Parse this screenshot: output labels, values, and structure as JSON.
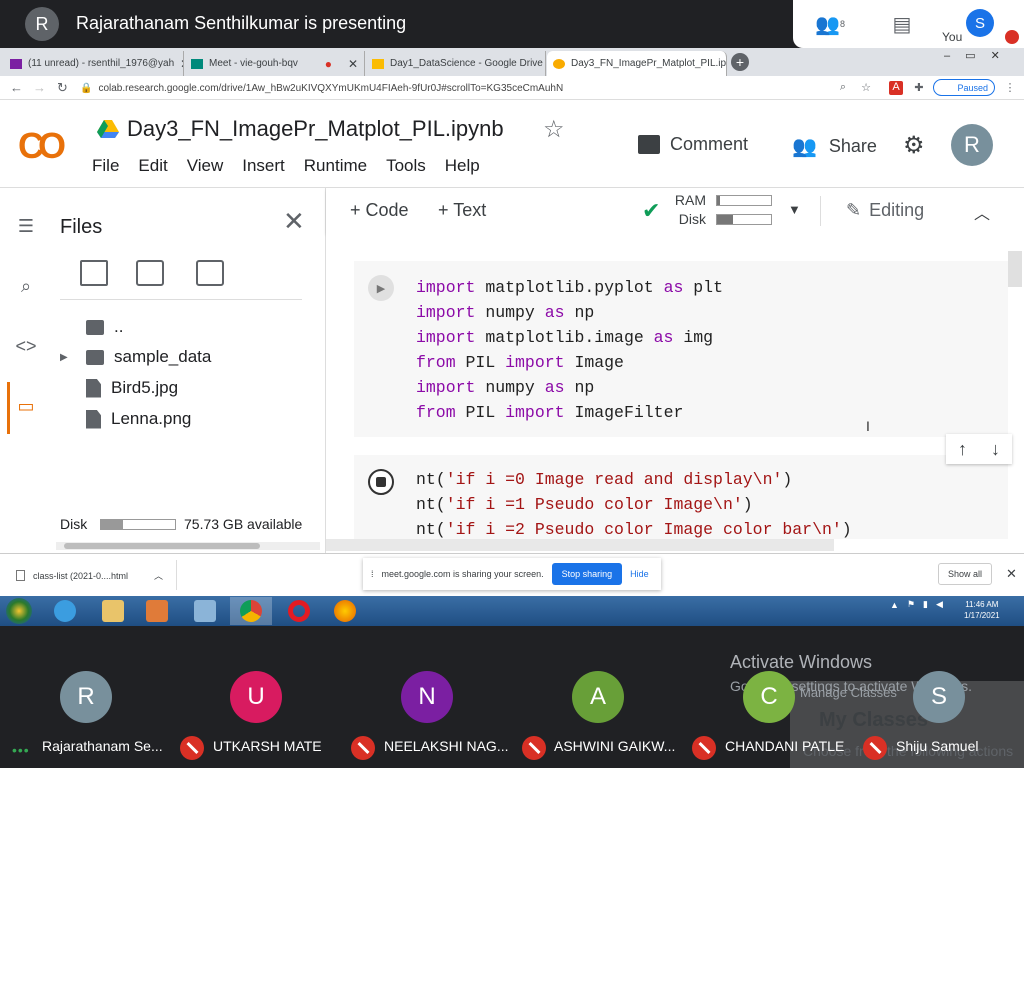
{
  "meet": {
    "presenter_initial": "R",
    "presenting_text": "Rajarathanam Senthilkumar is presenting",
    "participants_count": "8",
    "self_initial": "S",
    "self_label": "You"
  },
  "browser": {
    "tabs": [
      {
        "label": "(11 unread) - rsenthil_1976@yah",
        "favicon": "mail-icon"
      },
      {
        "label": "Meet - vie-gouh-bqv",
        "favicon": "meet-icon"
      },
      {
        "label": "Day1_DataScience - Google Drive",
        "favicon": "drive-icon"
      },
      {
        "label": "Day3_FN_ImagePr_Matplot_PIL.ip",
        "favicon": "colab-icon"
      }
    ],
    "url": "colab.research.google.com/drive/1Aw_hBw2uKIVQXYmUKmU4FIAeh-9fUr0J#scrollTo=KG35ceCmAuhN",
    "profile_status": "Paused"
  },
  "colab": {
    "logo": "CO",
    "notebook_title": "Day3_FN_ImagePr_Matplot_PIL.ipynb",
    "menus": [
      "File",
      "Edit",
      "View",
      "Insert",
      "Runtime",
      "Tools",
      "Help"
    ],
    "comment_label": "Comment",
    "share_label": "Share",
    "avatar_initial": "R",
    "toolbar": {
      "add_code": "+ Code",
      "add_text": "+ Text",
      "ram_label": "RAM",
      "disk_label": "Disk",
      "ram_usage": 0.05,
      "disk_usage": 0.3,
      "editing_label": "Editing"
    }
  },
  "files_panel": {
    "title": "Files",
    "items": [
      {
        "name": "..",
        "type": "parent"
      },
      {
        "name": "sample_data",
        "type": "folder"
      },
      {
        "name": "Bird5.jpg",
        "type": "file"
      },
      {
        "name": "Lenna.png",
        "type": "file"
      }
    ],
    "disk_label": "Disk",
    "disk_usage": 0.3,
    "disk_available": "75.73 GB available"
  },
  "cells": {
    "cell1": [
      [
        {
          "t": "import",
          "c": "kw"
        },
        {
          "t": " matplotlib.pyplot ",
          "c": ""
        },
        {
          "t": "as",
          "c": "kw"
        },
        {
          "t": " plt",
          "c": ""
        }
      ],
      [
        {
          "t": "import",
          "c": "kw"
        },
        {
          "t": " numpy ",
          "c": ""
        },
        {
          "t": "as",
          "c": "kw"
        },
        {
          "t": " np",
          "c": ""
        }
      ],
      [
        {
          "t": "import",
          "c": "kw"
        },
        {
          "t": " matplotlib.image ",
          "c": ""
        },
        {
          "t": "as",
          "c": "kw"
        },
        {
          "t": " img",
          "c": ""
        }
      ],
      [
        {
          "t": "from",
          "c": "kw"
        },
        {
          "t": " PIL ",
          "c": ""
        },
        {
          "t": "import",
          "c": "kw"
        },
        {
          "t": " Image",
          "c": ""
        }
      ],
      [
        {
          "t": "import",
          "c": "kw"
        },
        {
          "t": " numpy ",
          "c": ""
        },
        {
          "t": "as",
          "c": "kw"
        },
        {
          "t": " np",
          "c": ""
        }
      ],
      [
        {
          "t": "from",
          "c": "kw"
        },
        {
          "t": " PIL ",
          "c": ""
        },
        {
          "t": "import",
          "c": "kw"
        },
        {
          "t": " ImageFilter",
          "c": ""
        }
      ]
    ],
    "cell2": [
      [
        {
          "t": "nt(",
          "c": ""
        },
        {
          "t": "'if i =0 Image read and display\\n'",
          "c": "str"
        },
        {
          "t": ")",
          "c": ""
        }
      ],
      [
        {
          "t": "nt(",
          "c": ""
        },
        {
          "t": "'if i =1 Pseudo color Image\\n'",
          "c": "str"
        },
        {
          "t": ")",
          "c": ""
        }
      ],
      [
        {
          "t": "nt(",
          "c": ""
        },
        {
          "t": "'if i =2 Pseudo color Image color bar\\n'",
          "c": "str"
        },
        {
          "t": ")",
          "c": ""
        }
      ]
    ]
  },
  "downloads": {
    "item": "class-list (2021-0....html",
    "share_notice": "meet.google.com is sharing your screen.",
    "stop_sharing": "Stop sharing",
    "hide": "Hide",
    "show_all": "Show all"
  },
  "taskbar": {
    "time": "11:46 AM",
    "date": "1/17/2021"
  },
  "overlay": {
    "activate_title": "Activate Windows",
    "activate_sub": "Go to PC settings to activate Windows.",
    "manage_classes": "Manage Classes",
    "my_classes": "My Classes",
    "choose": "Choose from the following actions"
  },
  "participants": [
    {
      "initial": "R",
      "name": "Rajarathanam Se...",
      "color": "#78909c",
      "muted": false
    },
    {
      "initial": "U",
      "name": "UTKARSH MATE",
      "color": "#d81b60",
      "muted": true
    },
    {
      "initial": "N",
      "name": "NEELAKSHI NAG...",
      "color": "#7b1fa2",
      "muted": true
    },
    {
      "initial": "A",
      "name": "ASHWINI GAIKW...",
      "color": "#689f38",
      "muted": true
    },
    {
      "initial": "C",
      "name": "CHANDANI PATLE",
      "color": "#7cb342",
      "muted": true
    },
    {
      "initial": "S",
      "name": "Shiju Samuel",
      "color": "#78909c",
      "muted": true
    }
  ]
}
